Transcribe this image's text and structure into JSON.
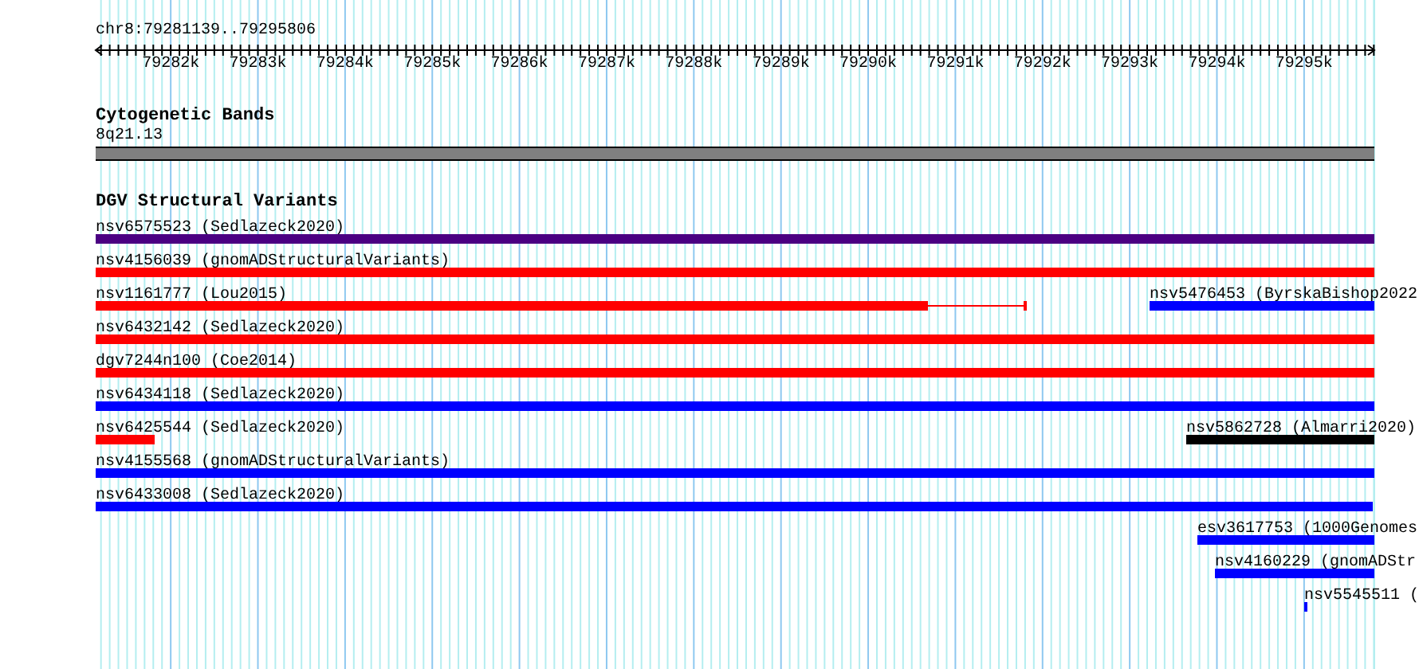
{
  "ruler": {
    "location": "chr8:79281139..79295806",
    "ticks": [
      "79282k",
      "79283k",
      "79284k",
      "79285k",
      "79286k",
      "79287k",
      "79288k",
      "79289k",
      "79290k",
      "79291k",
      "79292k",
      "79293k",
      "79294k",
      "79295k"
    ]
  },
  "cytoband_track": {
    "title": "Cytogenetic Bands",
    "band": {
      "label": "8q21.13",
      "color": "#808080"
    }
  },
  "dgv_track": {
    "title": "DGV Structural Variants",
    "features": [
      {
        "label": "nsv6575523 (Sedlazeck2020)",
        "color": "#4b0082",
        "kind": "bar"
      },
      {
        "label": "nsv4156039 (gnomADStructuralVariants)",
        "color": "#ff0000",
        "kind": "bar"
      },
      {
        "label": "nsv1161777 (Lou2015)",
        "color": "#ff0000",
        "kind": "bar_with_line"
      },
      {
        "label": "nsv5476453 (ByrskaBishop2022",
        "color": "#0000ff",
        "kind": "bar"
      },
      {
        "label": "nsv6432142 (Sedlazeck2020)",
        "color": "#ff0000",
        "kind": "bar"
      },
      {
        "label": "dgv7244n100 (Coe2014)",
        "color": "#ff0000",
        "kind": "bar"
      },
      {
        "label": "nsv6434118 (Sedlazeck2020)",
        "color": "#0000ff",
        "kind": "bar"
      },
      {
        "label": "nsv6425544 (Sedlazeck2020)",
        "color": "#ff0000",
        "kind": "bar"
      },
      {
        "label": "nsv5862728 (Almarri2020)",
        "color": "#000000",
        "kind": "bar"
      },
      {
        "label": "nsv4155568 (gnomADStructuralVariants)",
        "color": "#0000ff",
        "kind": "bar"
      },
      {
        "label": "nsv6433008 (Sedlazeck2020)",
        "color": "#0000ff",
        "kind": "bar"
      },
      {
        "label": "esv3617753 (1000Genomes",
        "color": "#0000ff",
        "kind": "bar"
      },
      {
        "label": "nsv4160229 (gnomADStr",
        "color": "#0000ff",
        "kind": "bar"
      },
      {
        "label": "nsv5545511 (",
        "color": "#0000ff",
        "kind": "bar"
      }
    ]
  }
}
